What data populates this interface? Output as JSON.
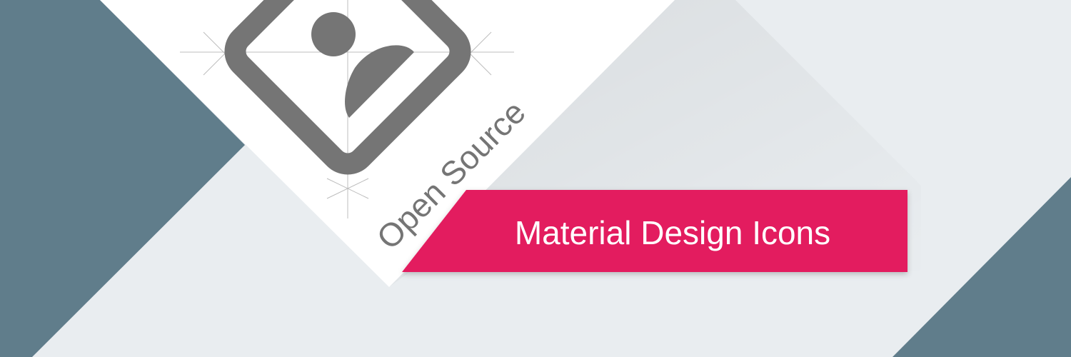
{
  "banner": {
    "title": "Material Design Icons",
    "tagline": "Open Source",
    "logo_icon": "account-box-outline-icon",
    "colors": {
      "background": "#e9edf0",
      "slate": "#607d8b",
      "accent": "#e31c5f",
      "paper": "#ffffff",
      "icon": "#757575",
      "keyline": "#bdbdbd",
      "title_text": "#ffffff",
      "tagline_text": "#757575"
    }
  }
}
